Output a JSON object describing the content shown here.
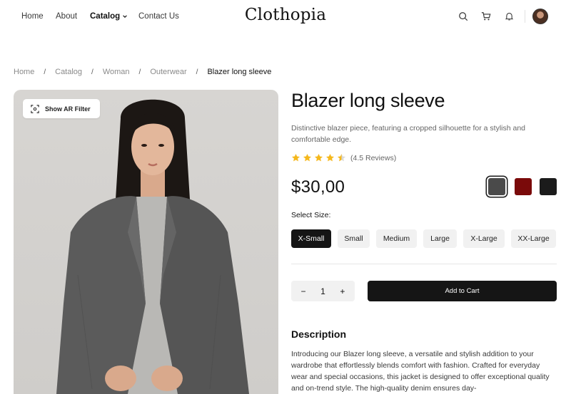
{
  "header": {
    "logo": "Clothopia",
    "nav": {
      "home": "Home",
      "about": "About",
      "catalog": "Catalog",
      "contact": "Contact Us"
    },
    "icons": [
      "search-icon",
      "cart-icon",
      "bell-icon",
      "avatar"
    ]
  },
  "breadcrumb": {
    "items": [
      "Home",
      "Catalog",
      "Woman",
      "Outerwear"
    ],
    "current": "Blazer long sleeve",
    "separator": "/"
  },
  "image": {
    "ar_button_label": "Show AR Filter"
  },
  "product": {
    "title": "Blazer long sleeve",
    "subtitle": "Distinctive blazer piece, featuring a cropped silhouette for a stylish and comfortable edge.",
    "rating": 4.5,
    "reviews_label": "(4.5 Reviews)",
    "price": "$30,00",
    "colors": [
      {
        "hex": "#4a4a4a",
        "selected": true
      },
      {
        "hex": "#7a0a0a",
        "selected": false
      },
      {
        "hex": "#1b1b1b",
        "selected": false
      }
    ],
    "size_label": "Select Size:",
    "sizes": [
      {
        "label": "X-Small",
        "active": true
      },
      {
        "label": "Small",
        "active": false
      },
      {
        "label": "Medium",
        "active": false
      },
      {
        "label": "Large",
        "active": false
      },
      {
        "label": "X-Large",
        "active": false
      },
      {
        "label": "XX-Large",
        "active": false
      }
    ],
    "quantity": "1",
    "minus": "−",
    "plus": "+",
    "add_to_cart": "Add to Cart"
  },
  "description": {
    "title": "Description",
    "body": "Introducing our Blazer long sleeve, a versatile and stylish addition to your wardrobe that effortlessly blends comfort with fashion. Crafted for everyday wear and special occasions, this jacket is designed to offer exceptional quality and on-trend style. The high-quality denim ensures day-"
  },
  "colors": {
    "star": "#f5b81c",
    "dark": "#151515",
    "chip": "#f1f1f1"
  }
}
